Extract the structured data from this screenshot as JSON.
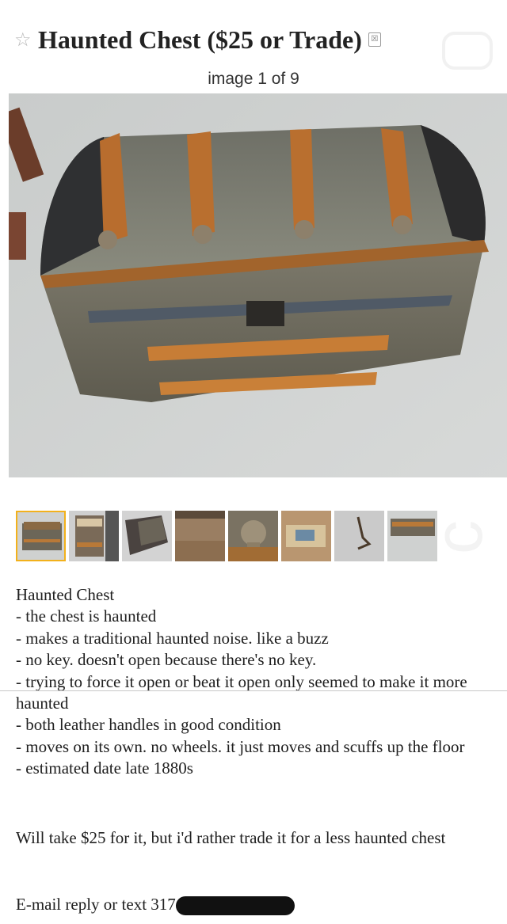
{
  "listing": {
    "title": "Haunted Chest ($25 or Trade)",
    "image_counter": "image 1 of 9",
    "star_icon": "☆",
    "flag_icon": "☒"
  },
  "thumbnails": [
    {
      "name": "thumbnail-1",
      "active": true
    },
    {
      "name": "thumbnail-2",
      "active": false
    },
    {
      "name": "thumbnail-3",
      "active": false
    },
    {
      "name": "thumbnail-4",
      "active": false
    },
    {
      "name": "thumbnail-5",
      "active": false
    },
    {
      "name": "thumbnail-6",
      "active": false
    },
    {
      "name": "thumbnail-7",
      "active": false
    },
    {
      "name": "thumbnail-8",
      "active": false
    }
  ],
  "description": {
    "heading": "Haunted Chest",
    "items": [
      "- the chest is haunted",
      "- makes a traditional haunted noise. like a buzz",
      "- no key. doesn't open because there's no key.",
      "- trying to force it open or beat it open only seemed to make it more haunted",
      "- both leather handles in good condition",
      "- moves on its own. no wheels. it just moves and scuffs up the floor",
      "- estimated date late 1880s"
    ],
    "trade_note": "Will take $25 for it, but i'd rather trade it for a less haunted chest",
    "contact": "E-mail reply or text 317"
  },
  "colors": {
    "accent_thumb_border": "#f2b11c",
    "text": "#202020"
  }
}
